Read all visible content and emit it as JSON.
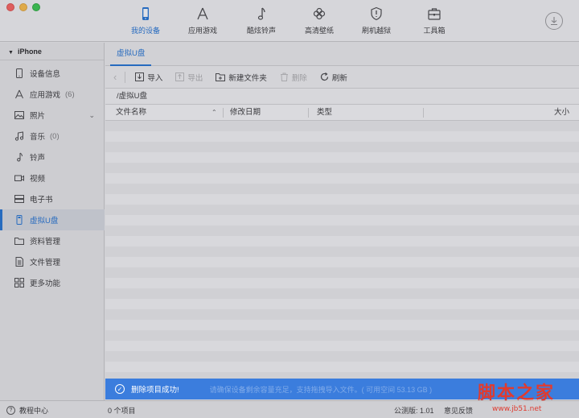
{
  "toolbar": {
    "nav": [
      {
        "label": "我的设备",
        "icon": "phone-icon",
        "active": true
      },
      {
        "label": "应用游戏",
        "icon": "app-store-icon",
        "active": false
      },
      {
        "label": "酷炫铃声",
        "icon": "music-note-icon",
        "active": false
      },
      {
        "label": "高清壁纸",
        "icon": "flower-icon",
        "active": false
      },
      {
        "label": "刷机越狱",
        "icon": "shield-icon",
        "active": false
      },
      {
        "label": "工具箱",
        "icon": "toolbox-icon",
        "active": false
      }
    ],
    "download_icon": "download-icon"
  },
  "sidebar": {
    "device_name": "iPhone",
    "items": [
      {
        "label": "设备信息",
        "icon": "device-info-icon",
        "count": ""
      },
      {
        "label": "应用游戏",
        "icon": "app-icon",
        "count": "(6)"
      },
      {
        "label": "照片",
        "icon": "photo-icon",
        "count": ""
      },
      {
        "label": "音乐",
        "icon": "music-icon",
        "count": "(0)"
      },
      {
        "label": "铃声",
        "icon": "ringtone-icon",
        "count": ""
      },
      {
        "label": "视频",
        "icon": "video-icon",
        "count": ""
      },
      {
        "label": "电子书",
        "icon": "ebook-icon",
        "count": ""
      },
      {
        "label": "虚拟U盘",
        "icon": "usb-disk-icon",
        "count": ""
      },
      {
        "label": "资料管理",
        "icon": "folder-icon",
        "count": ""
      },
      {
        "label": "文件管理",
        "icon": "file-icon",
        "count": ""
      },
      {
        "label": "更多功能",
        "icon": "grid-icon",
        "count": ""
      }
    ],
    "active_index": 7
  },
  "main": {
    "tab": "虚拟U盘",
    "actions": {
      "import": "导入",
      "export": "导出",
      "new_folder": "新建文件夹",
      "delete": "删除",
      "refresh": "刷新"
    },
    "path": "/虚拟U盘",
    "columns": {
      "name": "文件名称",
      "date": "修改日期",
      "type": "类型",
      "size": "大小"
    }
  },
  "notice": {
    "message": "删除项目成功!",
    "background_text": "请确保设备剩余容量充足，支持拖拽导入文件。( 可用空间 53.13 GB )"
  },
  "status": {
    "help": "教程中心",
    "count": "0 个项目",
    "version": "公测版: 1.01",
    "feedback": "意见反馈"
  },
  "watermark": {
    "text": "脚本之家",
    "url": "www.jb51.net"
  },
  "colors": {
    "accent": "#1c6fd1",
    "notice": "#3b7ddd",
    "watermark": "#e03b2f"
  }
}
